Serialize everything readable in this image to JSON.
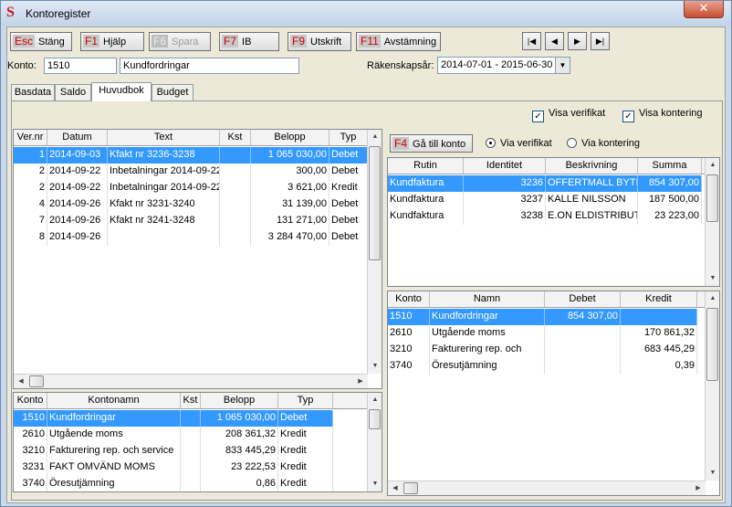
{
  "window": {
    "title": "Kontoregister",
    "close_glyph": "✕",
    "app_icon": "S"
  },
  "toolbar": {
    "buttons": [
      {
        "key": "Esc",
        "label": "Stäng"
      },
      {
        "key": "F1",
        "label": "Hjälp"
      },
      {
        "key": "F6",
        "label": "Spara"
      },
      {
        "key": "F7",
        "label": "IB"
      },
      {
        "key": "F9",
        "label": "Utskrift"
      },
      {
        "key": "F11",
        "label": "Avstämning"
      }
    ],
    "nav": [
      "|◀",
      "◀",
      "▶",
      "▶|"
    ]
  },
  "konto": {
    "label": "Konto:",
    "number": "1510",
    "name": "Kundfordringar"
  },
  "rakenskapsar": {
    "label": "Räkenskapsår:",
    "value": "2014-07-01 - 2015-06-30"
  },
  "tabs": [
    "Basdata",
    "Saldo",
    "Huvudbok",
    "Budget"
  ],
  "options": {
    "visa_verifikat": "Visa verifikat",
    "visa_kontering": "Visa kontering",
    "check": "✓"
  },
  "ledger": {
    "headers": [
      "Ver.nr",
      "Datum",
      "Text",
      "Kst",
      "Belopp",
      "Typ"
    ],
    "rows": [
      [
        "1",
        "2014-09-03",
        "Kfakt nr 3236-3238",
        "",
        "1 065 030,00",
        "Debet"
      ],
      [
        "2",
        "2014-09-22",
        "Inbetalningar 2014-09-22",
        "",
        "300,00",
        "Debet"
      ],
      [
        "2",
        "2014-09-22",
        "Inbetalningar 2014-09-22",
        "",
        "3 621,00",
        "Kredit"
      ],
      [
        "4",
        "2014-09-26",
        "Kfakt nr 3231-3240",
        "",
        "31 139,00",
        "Debet"
      ],
      [
        "7",
        "2014-09-26",
        "Kfakt nr 3241-3248",
        "",
        "131 271,00",
        "Debet"
      ],
      [
        "8",
        "2014-09-26",
        "",
        "",
        "3 284 470,00",
        "Debet"
      ]
    ]
  },
  "summary": {
    "headers": [
      "Konto",
      "Kontonamn",
      "Kst",
      "Belopp",
      "Typ"
    ],
    "rows": [
      [
        "1510",
        "Kundfordringar",
        "",
        "1 065 030,00",
        "Debet"
      ],
      [
        "2610",
        "Utgående moms",
        "",
        "208 361,32",
        "Kredit"
      ],
      [
        "3210",
        "Fakturering rep. och service",
        "",
        "833 445,29",
        "Kredit"
      ],
      [
        "3231",
        "FAKT OMVÄND MOMS",
        "",
        "23 222,53",
        "Kredit"
      ],
      [
        "3740",
        "Öresutjämning",
        "",
        "0,86",
        "Kredit"
      ]
    ]
  },
  "goto": {
    "key": "F4",
    "label": "Gå till konto"
  },
  "radios": {
    "via_verifikat": "Via verifikat",
    "via_kontering": "Via kontering"
  },
  "source": {
    "headers": [
      "Rutin",
      "Identitet",
      "Beskrivning",
      "Summa"
    ],
    "rows": [
      [
        "Kundfaktura",
        "3236",
        "OFFERTMALL BYTE",
        "854 307,00"
      ],
      [
        "Kundfaktura",
        "3237",
        "KALLE NILSSON",
        "187 500,00"
      ],
      [
        "Kundfaktura",
        "3238",
        "E.ON ELDISTRIBUTIC",
        "23 223,00"
      ]
    ]
  },
  "posting": {
    "headers": [
      "Konto",
      "Namn",
      "Debet",
      "Kredit"
    ],
    "rows": [
      [
        "1510",
        "Kundfordringar",
        "854 307,00",
        ""
      ],
      [
        "2610",
        "Utgående moms",
        "",
        "170 861,32"
      ],
      [
        "3210",
        "Fakturering rep. och",
        "",
        "683 445,29"
      ],
      [
        "3740",
        "Öresutjämning",
        "",
        "0,39"
      ]
    ]
  }
}
